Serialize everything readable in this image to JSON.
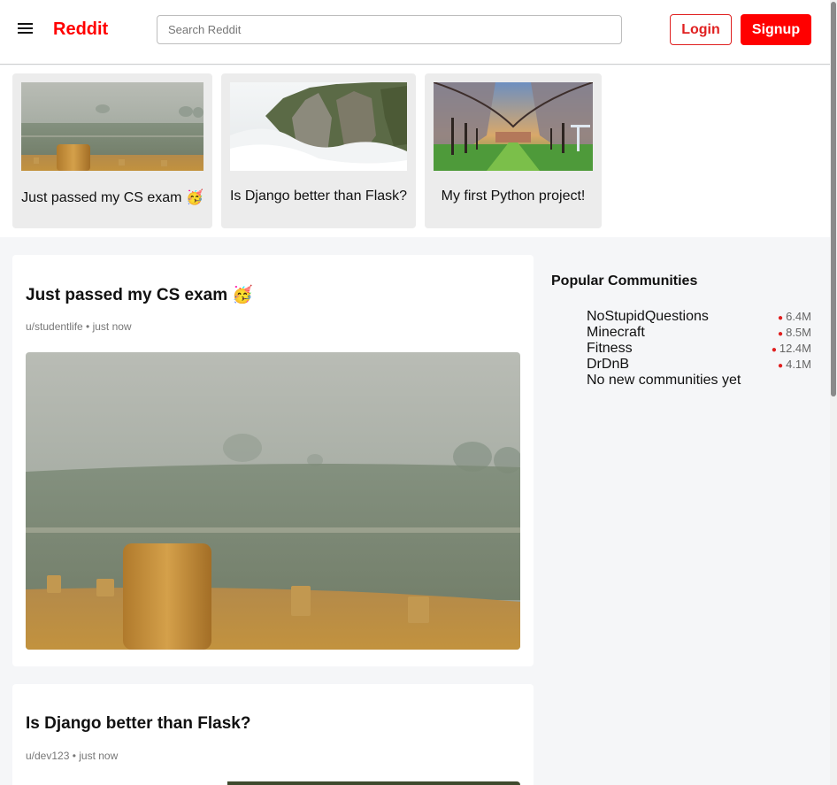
{
  "header": {
    "logo": "Reddit",
    "search_placeholder": "Search Reddit",
    "login_label": "Login",
    "signup_label": "Signup"
  },
  "carousel": [
    {
      "title": "Just passed my CS exam 🥳",
      "image": "foggy-hay-bales-field"
    },
    {
      "title": "Is Django better than Flask?",
      "image": "misty-cliff"
    },
    {
      "title": "My first Python project!",
      "image": "autumn-tree-avenue"
    }
  ],
  "posts": [
    {
      "title": "Just passed my CS exam 🥳",
      "meta": "u/studentlife • just now",
      "image": "foggy-hay-bales-field"
    },
    {
      "title": "Is Django better than Flask?",
      "meta": "u/dev123 • just now",
      "image": "misty-cliff"
    }
  ],
  "sidebar": {
    "title": "Popular Communities",
    "communities": [
      {
        "name": "NoStupidQuestions",
        "members": "6.4M"
      },
      {
        "name": "Minecraft",
        "members": "8.5M"
      },
      {
        "name": "Fitness",
        "members": "12.4M"
      },
      {
        "name": "DrDnB",
        "members": "4.1M"
      }
    ],
    "empty_message": "No new communities yet"
  },
  "colors": {
    "brand": "#ff0000",
    "background": "#f5f6f8"
  }
}
